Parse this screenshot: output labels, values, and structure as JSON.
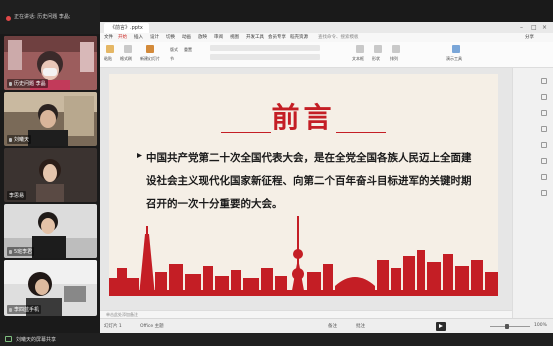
{
  "meeting": {
    "recording_text": "正在讲话: 历史问题 李晶;",
    "participants": [
      {
        "name": "历史问题 李晶"
      },
      {
        "name": "刘曦天"
      },
      {
        "name": "李思易"
      },
      {
        "name": "5班李君"
      },
      {
        "name": "李四蓝手机"
      }
    ],
    "share_status": "刘曦天的屏幕共享"
  },
  "wps": {
    "tab_title": "《前言》.pptx",
    "menu_items": [
      "文件",
      "开始",
      "插入",
      "设计",
      "切换",
      "动画",
      "放映",
      "审阅",
      "视图",
      "开发工具",
      "会员专享",
      "稻壳资源"
    ],
    "menu_search": "查找命令、搜索模板",
    "ribbon_labels": [
      "粘贴",
      "格式刷",
      "新建幻灯片",
      "版式",
      "节",
      "重置",
      "文本框",
      "形状",
      "排列",
      "演示工具"
    ],
    "share_label": "分享",
    "slide": {
      "title": "前言",
      "body": "中国共产党第二十次全国代表大会，是在全党全国各族人民迈上全面建设社会主义现代化国家新征程、向第二个百年奋斗目标进军的关键时期召开的一次十分重要的大会。"
    },
    "notes_placeholder": "单击此处添加备注",
    "status": {
      "left": "幻灯片 1",
      "theme": "Office 主题",
      "notes_btn": "备注",
      "comment_btn": "批注",
      "zoom": "100%"
    }
  }
}
